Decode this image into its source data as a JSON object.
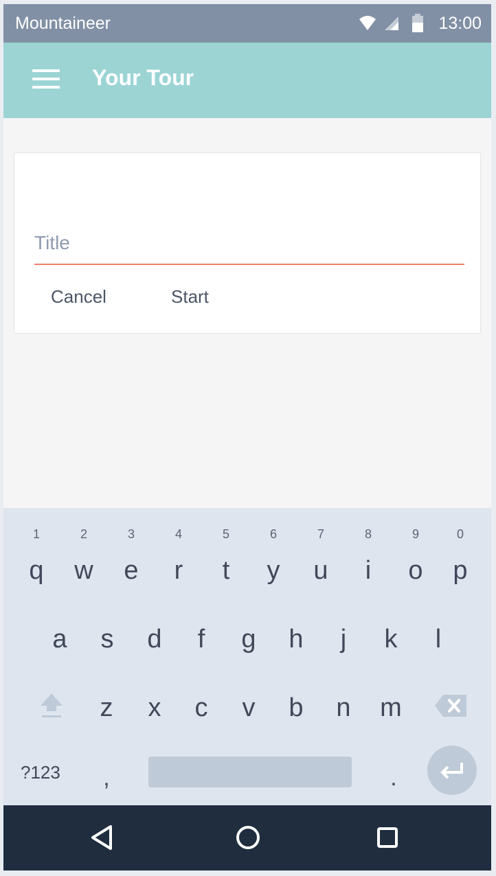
{
  "status_bar": {
    "app_name": "Mountaineer",
    "time": "13:00"
  },
  "app_bar": {
    "title": "Your Tour"
  },
  "dialog": {
    "title_placeholder": "Title",
    "title_value": "",
    "cancel_label": "Cancel",
    "start_label": "Start"
  },
  "keyboard": {
    "row1": [
      {
        "key": "q",
        "hint": "1"
      },
      {
        "key": "w",
        "hint": "2"
      },
      {
        "key": "e",
        "hint": "3"
      },
      {
        "key": "r",
        "hint": "4"
      },
      {
        "key": "t",
        "hint": "5"
      },
      {
        "key": "y",
        "hint": "6"
      },
      {
        "key": "u",
        "hint": "7"
      },
      {
        "key": "i",
        "hint": "8"
      },
      {
        "key": "o",
        "hint": "9"
      },
      {
        "key": "p",
        "hint": "0"
      }
    ],
    "row2": [
      "a",
      "s",
      "d",
      "f",
      "g",
      "h",
      "j",
      "k",
      "l"
    ],
    "row3": [
      "z",
      "x",
      "c",
      "v",
      "b",
      "n",
      "m"
    ],
    "symbols_label": "?123",
    "comma": ",",
    "period": "."
  },
  "colors": {
    "status_bar": "#8190a5",
    "app_bar": "#9cd4d4",
    "accent_underline": "#f07d68",
    "keyboard_bg": "#dfe5ee",
    "nav_bar": "#1f2d3f"
  },
  "icons": [
    "wifi-icon",
    "signal-icon",
    "battery-icon",
    "menu-icon",
    "shift-icon",
    "backspace-icon",
    "enter-icon",
    "back-icon",
    "home-icon",
    "recents-icon"
  ]
}
